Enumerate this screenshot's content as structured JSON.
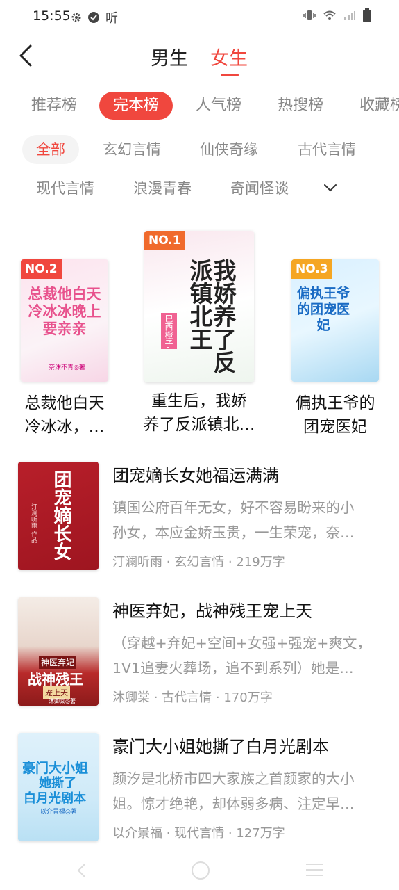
{
  "status_bar": {
    "time": "15:55",
    "icons_left": [
      "gear-icon",
      "check-circle-icon",
      "listen-icon"
    ],
    "listen_text": "听",
    "icons_right": [
      "vibrate-icon",
      "wifi-icon",
      "signal-icon",
      "battery-icon"
    ]
  },
  "header": {
    "back_icon": "chevron-left-icon",
    "gender_tabs": [
      "男生",
      "女生"
    ],
    "active_gender": "女生"
  },
  "rank_tabs": [
    "推荐榜",
    "完本榜",
    "人气榜",
    "热搜榜",
    "收藏榜"
  ],
  "active_rank_tab": "完本榜",
  "categories_row1": [
    "全部",
    "玄幻言情",
    "仙侠奇缘",
    "古代言情"
  ],
  "categories_row2": [
    "现代言情",
    "浪漫青春",
    "奇闻怪谈"
  ],
  "active_category": "全部",
  "expand_icon": "chevron-down-icon",
  "top_books": [
    {
      "rank": "NO.2",
      "title": "总裁他白天冷冰冰，…",
      "title_line1": "总裁他白天",
      "title_line2": "冷冰冰，…",
      "cover_text": "总裁他白天冷冰冰晚上要亲亲",
      "cover_author": "奈沫不青◎著",
      "badge_color": "#f0473e"
    },
    {
      "rank": "NO.1",
      "title": "重生后，我娇养了反派镇北…",
      "title_line1": "重生后，我娇",
      "title_line2": "养了反派镇北…",
      "cover_text": "我娇养了反派镇北王",
      "cover_author": "巴西橙子",
      "badge_color": "#f06a2c"
    },
    {
      "rank": "NO.3",
      "title": "偏执王爷的团宠医妃",
      "title_line1": "偏执王爷的",
      "title_line2": "团宠医妃",
      "cover_text": "偏执王爷的团宠医妃",
      "badge_color": "#f5a623"
    }
  ],
  "book_list": [
    {
      "title": "团宠嫡长女她福运满满",
      "desc": "镇国公府百年无女，好不容易盼来的小孙女，本应金娇玉贵，一生荣宠，奈…",
      "desc_line1": "镇国公府百年无女，好不容易盼来的小",
      "desc_line2": "孙女，本应金娇玉贵，一生荣宠，奈…",
      "author": "汀澜听雨",
      "category": "玄幻言情",
      "words": "219万字",
      "cover_text": "团宠嫡长女",
      "cover_author": "汀澜听雨 作品"
    },
    {
      "title": "神医弃妃，战神残王宠上天",
      "desc": "（穿越+弃妃+空间+女强+强宠+爽文，1V1追妻火葬场，追不到系列）她是…",
      "desc_line1": "（穿越+弃妃+空间+女强+强宠+爽文，",
      "desc_line2": "1V1追妻火葬场，追不到系列）她是…",
      "author": "沐卿棠",
      "category": "古代言情",
      "words": "170万字",
      "cover_text": "神医弃妃",
      "cover_text2": "战神残王",
      "cover_text3": "宠上天",
      "cover_author": "沐卿棠◎著"
    },
    {
      "title": "豪门大小姐她撕了白月光剧本",
      "desc": "颜汐是北桥市四大家族之首颜家的大小姐。惊才绝艳，却体弱多病、注定早…",
      "desc_line1": "颜汐是北桥市四大家族之首颜家的大小",
      "desc_line2": "姐。惊才绝艳，却体弱多病、注定早…",
      "author": "以介景福",
      "category": "现代言情",
      "words": "127万字",
      "cover_text": "豪门大小姐",
      "cover_text2": "她撕了",
      "cover_text3": "白月光剧本",
      "cover_author": "以介景福◎著"
    }
  ],
  "meta_separator": " · ",
  "nav_bar": [
    "back-icon",
    "home-icon",
    "menu-icon"
  ]
}
